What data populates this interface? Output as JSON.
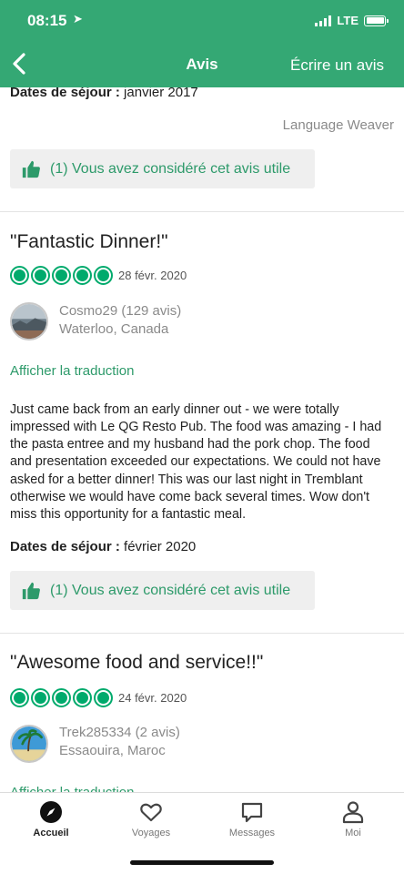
{
  "status": {
    "time": "08:15",
    "network": "LTE"
  },
  "nav": {
    "title": "Avis",
    "action": "Écrire un avis"
  },
  "review0": {
    "stay_label": "Dates de séjour :",
    "stay_value": "janvier 2017",
    "translator": "Language Weaver",
    "helpful": "(1) Vous avez considéré cet avis utile"
  },
  "reviews": [
    {
      "title": "\"Fantastic Dinner!\"",
      "rating": 5,
      "date": "28 févr. 2020",
      "user": "Cosmo29 (129 avis)",
      "location": "Waterloo, Canada",
      "translate": "Afficher la traduction",
      "text": "Just came back from an early dinner out - we were totally impressed with Le QG Resto Pub. The food was amazing - I had the pasta entree and my husband had the pork chop. The food and presentation exceeded our expectations. We could not have asked for a better dinner! This was our last night in Tremblant otherwise we would have come back several times. Wow don't miss this opportunity for a fantastic meal.",
      "stay_label": "Dates de séjour :",
      "stay_value": "février 2020",
      "helpful": "(1) Vous avez considéré cet avis utile"
    },
    {
      "title": "\"Awesome food and service!!\"",
      "rating": 5,
      "date": "24 févr. 2020",
      "user": "Trek285334 (2 avis)",
      "location": "Essaouira, Maroc",
      "translate": "Afficher la traduction"
    }
  ],
  "tabs": [
    {
      "label": "Accueil",
      "icon": "compass-icon",
      "active": true
    },
    {
      "label": "Voyages",
      "icon": "heart-icon",
      "active": false
    },
    {
      "label": "Messages",
      "icon": "message-icon",
      "active": false
    },
    {
      "label": "Moi",
      "icon": "person-icon",
      "active": false
    }
  ],
  "colors": {
    "brand": "#34a874",
    "rating": "#00aa6c",
    "link": "#2d9a6a"
  }
}
